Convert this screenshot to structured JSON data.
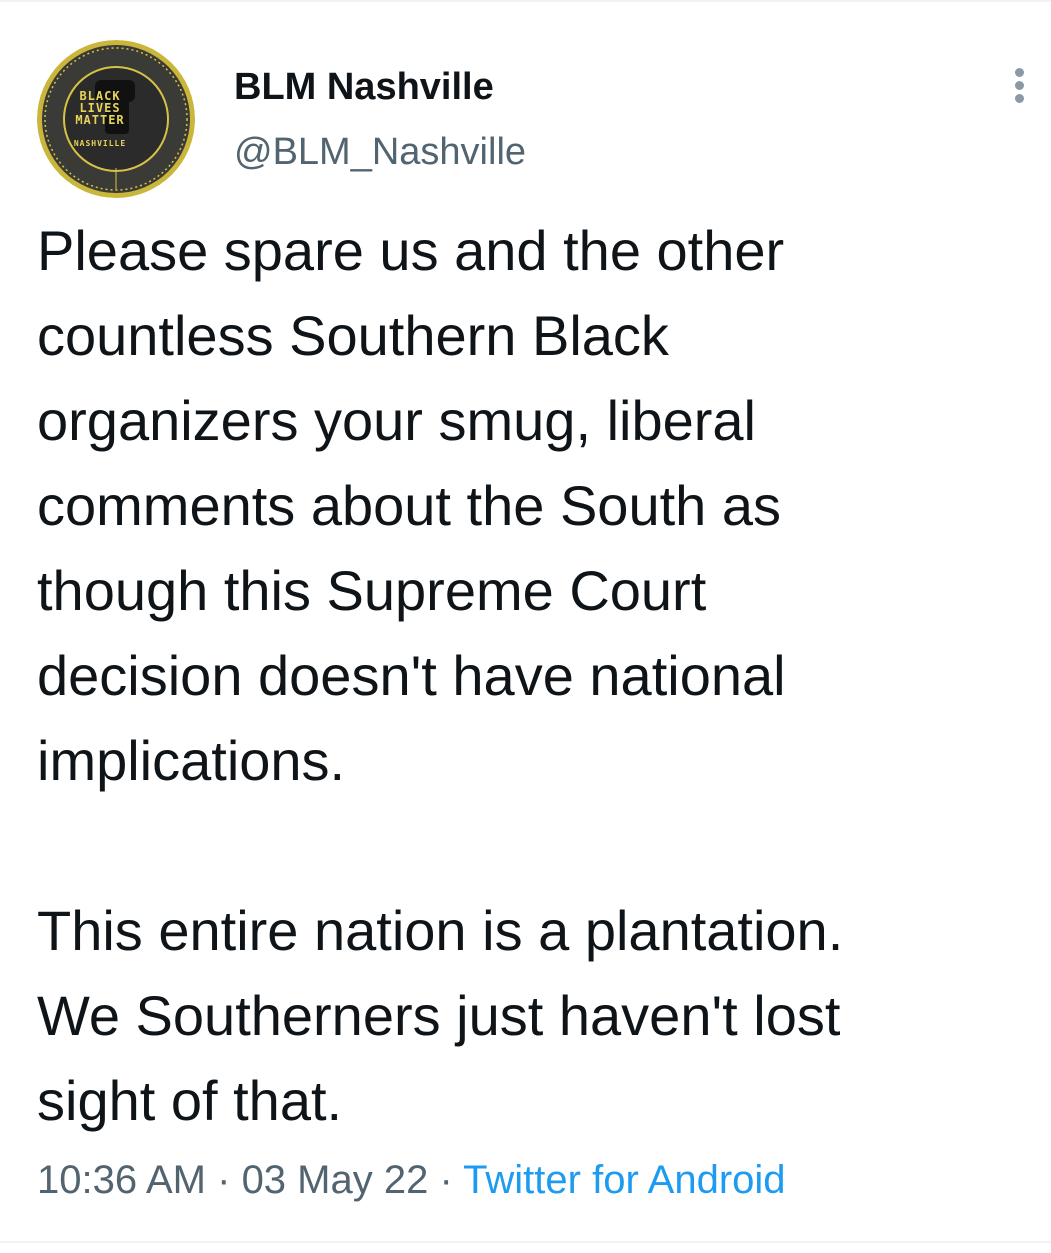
{
  "tweet": {
    "author": {
      "display_name": "BLM Nashville",
      "handle": "@BLM_Nashville",
      "avatar": {
        "line1": "BLACK",
        "line2": "LIVES",
        "line3": "MATTER",
        "line4": "NASHVILLE",
        "ring_color": "#d6c346",
        "bg_color": "#2b2b2b"
      }
    },
    "more_icon": "more-vertical-icon",
    "body": {
      "lines_para1": [
        "Please spare us and the other",
        "countless Southern Black",
        "organizers your smug, liberal",
        "comments about the South as",
        "though this Supreme Court",
        "decision doesn't have national",
        "implications."
      ],
      "lines_para2": [
        "This entire nation is a plantation.",
        "We Southerners just haven't lost",
        "sight of that."
      ]
    },
    "meta": {
      "time": "10:36 AM",
      "separator": " · ",
      "date": "03 May 22",
      "source": "Twitter for Android"
    }
  },
  "colors": {
    "text_primary": "#0f1419",
    "text_secondary": "#536471",
    "link": "#1d9bf0"
  }
}
